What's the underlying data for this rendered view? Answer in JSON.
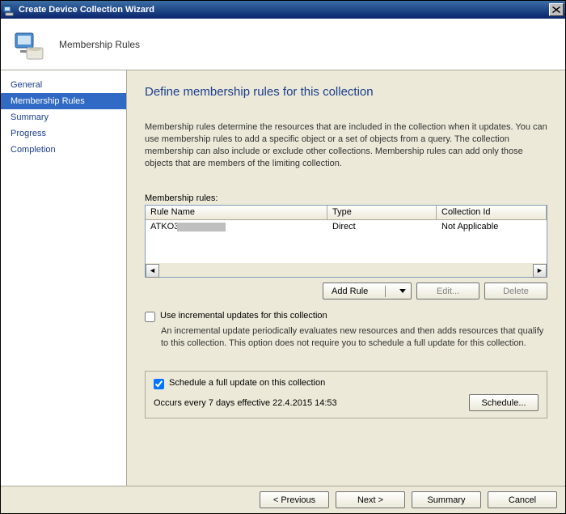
{
  "window": {
    "title": "Create Device Collection Wizard"
  },
  "header": {
    "title": "Membership Rules"
  },
  "sidebar": {
    "items": [
      {
        "label": "General"
      },
      {
        "label": "Membership Rules"
      },
      {
        "label": "Summary"
      },
      {
        "label": "Progress"
      },
      {
        "label": "Completion"
      }
    ],
    "active_index": 1
  },
  "content": {
    "heading": "Define membership rules for this collection",
    "description": "Membership rules determine the resources that are included in the collection when it updates. You can use membership rules to add a specific object or a set of objects from a query. The collection membership can also include or exclude other collections. Membership rules can add only those objects that are members of the limiting collection.",
    "rules_label": "Membership rules:",
    "columns": {
      "name": "Rule Name",
      "type": "Type",
      "cid": "Collection Id"
    },
    "rows": [
      {
        "name": "ATKO3",
        "type": "Direct",
        "cid": "Not Applicable"
      }
    ],
    "buttons": {
      "add": "Add Rule",
      "edit": "Edit...",
      "delete": "Delete"
    },
    "incremental": {
      "checked": false,
      "label": "Use incremental updates for this collection",
      "desc": "An incremental update periodically evaluates new resources and then adds resources that qualify to this collection. This option does not require you to schedule a full update for this collection."
    },
    "schedule": {
      "checked": true,
      "label": "Schedule a full update on this collection",
      "text": "Occurs every 7 days effective 22.4.2015 14:53",
      "button": "Schedule..."
    }
  },
  "footer": {
    "previous": "< Previous",
    "next": "Next >",
    "summary": "Summary",
    "cancel": "Cancel"
  }
}
